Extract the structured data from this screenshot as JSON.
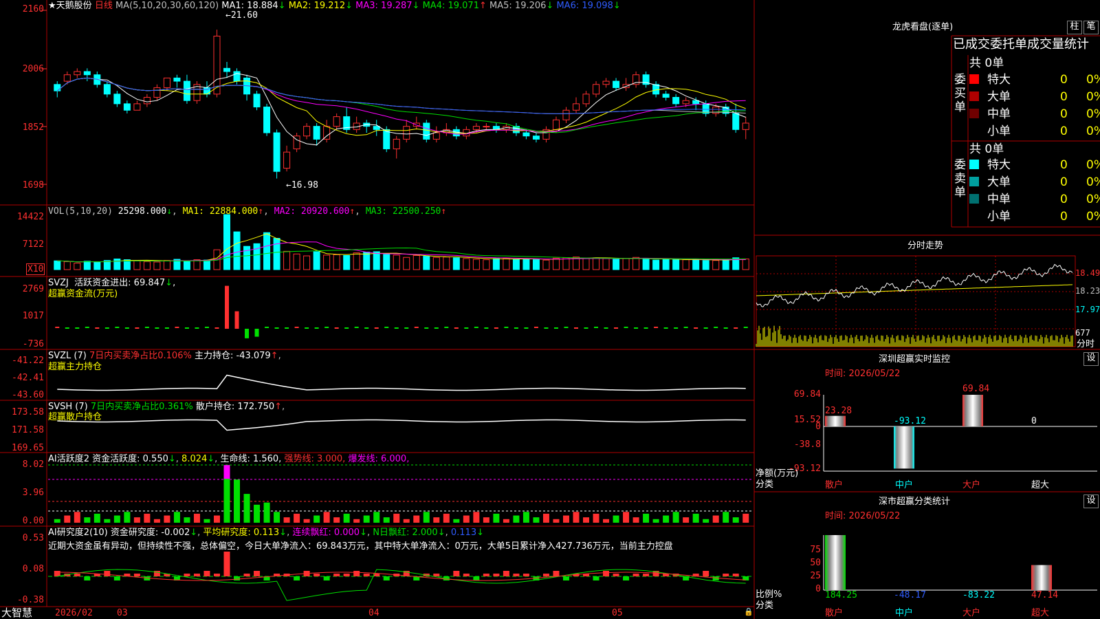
{
  "stock": {
    "name": "天鹅股份",
    "star": "★",
    "period": "日线"
  },
  "main": {
    "params": "MA(5,10,20,30,60,120)",
    "y_ticks": [
      "2160",
      "2006",
      "1852",
      "1698"
    ],
    "ma": [
      {
        "label": "MA1: 18.884",
        "arrow": "↓",
        "color": "#ffffff"
      },
      {
        "label": "MA2: 19.212",
        "arrow": "↓",
        "color": "#ffff00"
      },
      {
        "label": "MA3: 19.287",
        "arrow": "↓",
        "color": "#ff00ff"
      },
      {
        "label": "MA4: 19.071",
        "arrow": "↑",
        "color": "#00e000"
      },
      {
        "label": "MA5: 19.206",
        "arrow": "↓",
        "color": "#c0c0c0"
      },
      {
        "label": "MA6: 19.098",
        "arrow": "↓",
        "color": "#2f5cff"
      }
    ],
    "high_label": "21.60",
    "low_label": "16.98"
  },
  "vol": {
    "params": "VOL(5,10,20)",
    "value": "25298.000",
    "ma1": "MA1: 22884.000",
    "ma2": "MA2: 20920.600",
    "ma3": "MA3: 22500.250",
    "y_ticks": [
      "14422",
      "7122"
    ],
    "unit": "X10"
  },
  "svzj": {
    "label": "SVZJ",
    "desc": "活跃资金进出: 69.847",
    "title": "超赢资金流(万元)",
    "y_ticks": [
      "2769",
      "1017",
      "-736"
    ]
  },
  "svzl": {
    "label": "SVZL (7)",
    "ratio": "7日内买卖净占比0.106%",
    "hold": "主力持仓: -43.079",
    "title": "超赢主力持仓",
    "y_ticks": [
      "-41.22",
      "-42.41",
      "-43.60"
    ]
  },
  "svsh": {
    "label": "SVSH (7)",
    "ratio": "7日内买卖净占比0.361%",
    "hold": "散户持仓: 172.750",
    "title": "超赢散户持仓",
    "y_ticks": [
      "173.58",
      "171.58",
      "169.65"
    ]
  },
  "ai_active": {
    "label": "AI活跃度2",
    "active": "资金活跃度: 0.550",
    "v2": "8.024",
    "life": "生命线: 1.560,",
    "strong": "强势线: 3.000,",
    "burst": "爆发线: 6.000,",
    "y_ticks": [
      "8.02",
      "3.96",
      "0.00"
    ]
  },
  "ai_research": {
    "label": "AI研究度2(10)",
    "research": "资金研究度: -0.002",
    "avg": "平均研究度: 0.113",
    "lianxu": "连续飘红: 0.000",
    "nri": "N日飘红: 2.000",
    "last": "0.113",
    "y_ticks": [
      "0.53",
      "0.08",
      "-0.38"
    ],
    "comment": "近期大资金虽有异动，但持续性不强，总体偏空，今日大单净流入：69.843万元，其中特大单净流入：0万元，大单5日累计净入427.736万元，当前主力控盘"
  },
  "footer": {
    "brand": "大智慧",
    "dates": [
      "2026/02",
      "03",
      "04",
      "05"
    ]
  },
  "right": {
    "lhb": {
      "title": "龙虎看盘(逐单)",
      "btn_zhu": "柱",
      "btn_bi": "笔"
    },
    "tabs": [
      "已成交",
      "委托单",
      "成交量",
      "统计"
    ],
    "buy": {
      "side": "委买单",
      "total": "共 0单",
      "rows": [
        {
          "label": "特大",
          "val": "0",
          "pct": "0%",
          "color": "#ff0000"
        },
        {
          "label": "大单",
          "val": "0",
          "pct": "0%",
          "color": "#b00000"
        },
        {
          "label": "中单",
          "val": "0",
          "pct": "0%",
          "color": "#700000"
        },
        {
          "label": "小单",
          "val": "0",
          "pct": "0%",
          "color": ""
        }
      ]
    },
    "sell": {
      "side": "委卖单",
      "total": "共 0单",
      "rows": [
        {
          "label": "特大",
          "val": "0",
          "pct": "0%",
          "color": "#00ffff"
        },
        {
          "label": "大单",
          "val": "0",
          "pct": "0%",
          "color": "#00a0a0"
        },
        {
          "label": "中单",
          "val": "0",
          "pct": "0%",
          "color": "#007070"
        },
        {
          "label": "小单",
          "val": "0",
          "pct": "0%",
          "color": ""
        }
      ]
    },
    "intraday": {
      "title": "分时走势",
      "y_ticks": [
        "18.49",
        "18.23",
        "17.97"
      ],
      "vol_label": "677",
      "footer": "分时"
    },
    "sz_monitor": {
      "title": "深圳超赢实时监控",
      "btn": "设",
      "time": "时间: 2026/05/22",
      "y_ticks": [
        "69.84",
        "15.52",
        "0",
        "-38.8",
        "-93.12"
      ],
      "ylabel": "净额(万元)",
      "xlabel": "分类",
      "categories": [
        "散户",
        "中户",
        "大户",
        "超大"
      ],
      "values": [
        "23.28",
        "-93.12",
        "69.84",
        "0"
      ]
    },
    "sz_class": {
      "title": "深市超赢分类统计",
      "btn": "设",
      "time": "时间: 2026/05/22",
      "y_ticks": [
        "75",
        "50",
        "25",
        "0"
      ],
      "ylabel": "比例%",
      "xlabel": "分类",
      "categories": [
        "散户",
        "中户",
        "大户",
        "超大"
      ],
      "values": [
        "184.25",
        "-48.17",
        "-83.22",
        "47.14"
      ]
    }
  },
  "chart_data": [
    {
      "type": "candlestick",
      "title": "天鹅股份 日线",
      "ylim": [
        16.98,
        21.6
      ],
      "candles": [
        [
          19.9,
          19.7,
          20.0,
          19.5
        ],
        [
          20.0,
          20.2,
          20.3,
          19.9
        ],
        [
          20.2,
          20.3,
          20.4,
          20.1
        ],
        [
          20.3,
          20.2,
          20.4,
          20.0
        ],
        [
          20.2,
          19.9,
          20.3,
          19.8
        ],
        [
          19.9,
          19.6,
          20.0,
          19.5
        ],
        [
          19.6,
          19.3,
          19.7,
          19.2
        ],
        [
          19.3,
          19.1,
          19.4,
          19.0
        ],
        [
          19.1,
          19.3,
          19.4,
          19.1
        ],
        [
          19.3,
          19.5,
          19.6,
          19.2
        ],
        [
          19.5,
          19.8,
          19.9,
          19.4
        ],
        [
          19.8,
          20.1,
          20.1,
          19.7
        ],
        [
          20.1,
          20.0,
          20.2,
          19.8
        ],
        [
          20.0,
          19.4,
          20.2,
          19.3
        ],
        [
          19.4,
          19.9,
          20.0,
          19.3
        ],
        [
          19.8,
          19.6,
          20.0,
          19.5
        ],
        [
          19.6,
          21.4,
          21.6,
          19.5
        ],
        [
          20.4,
          20.3,
          20.6,
          20.1
        ],
        [
          20.3,
          20.0,
          20.4,
          19.9
        ],
        [
          20.1,
          19.6,
          20.2,
          19.4
        ],
        [
          19.6,
          19.2,
          19.7,
          19.1
        ],
        [
          19.2,
          18.4,
          19.3,
          18.3
        ],
        [
          18.4,
          17.2,
          18.5,
          16.98
        ],
        [
          17.3,
          17.8,
          18.0,
          17.2
        ],
        [
          17.9,
          18.3,
          18.4,
          17.8
        ],
        [
          18.3,
          18.6,
          18.7,
          18.2
        ],
        [
          18.6,
          18.2,
          18.7,
          18.0
        ],
        [
          18.2,
          18.6,
          18.8,
          18.1
        ],
        [
          18.6,
          18.9,
          19.0,
          18.5
        ],
        [
          18.9,
          18.5,
          19.2,
          18.4
        ],
        [
          18.5,
          18.7,
          18.9,
          18.4
        ],
        [
          18.7,
          18.6,
          18.8,
          18.4
        ],
        [
          18.6,
          18.5,
          18.8,
          18.3
        ],
        [
          18.5,
          17.9,
          18.6,
          17.8
        ],
        [
          17.9,
          18.2,
          18.3,
          17.6
        ],
        [
          18.2,
          18.6,
          18.8,
          18.1
        ],
        [
          18.6,
          18.7,
          18.9,
          18.5
        ],
        [
          18.7,
          18.2,
          18.8,
          18.1
        ],
        [
          18.2,
          18.4,
          18.6,
          18.1
        ],
        [
          18.4,
          18.5,
          18.7,
          18.3
        ],
        [
          18.5,
          18.3,
          18.6,
          18.2
        ],
        [
          18.3,
          18.5,
          18.6,
          18.2
        ],
        [
          18.5,
          18.6,
          18.7,
          18.4
        ],
        [
          18.6,
          18.6,
          18.7,
          18.5
        ],
        [
          18.6,
          18.5,
          18.7,
          18.4
        ],
        [
          18.5,
          18.6,
          18.7,
          18.4
        ],
        [
          18.6,
          18.4,
          18.7,
          18.3
        ],
        [
          18.4,
          18.3,
          18.5,
          18.2
        ],
        [
          18.3,
          18.2,
          18.4,
          18.1
        ],
        [
          18.2,
          18.5,
          18.6,
          18.1
        ],
        [
          18.5,
          18.8,
          18.9,
          18.4
        ],
        [
          18.8,
          19.1,
          19.2,
          18.7
        ],
        [
          19.1,
          19.3,
          19.5,
          19.0
        ],
        [
          19.3,
          19.6,
          19.7,
          19.2
        ],
        [
          19.6,
          19.9,
          20.0,
          19.5
        ],
        [
          19.9,
          20.0,
          20.1,
          19.8
        ],
        [
          20.0,
          19.8,
          20.1,
          19.7
        ],
        [
          19.8,
          19.9,
          20.1,
          19.7
        ],
        [
          19.9,
          20.2,
          20.3,
          19.8
        ],
        [
          20.2,
          19.9,
          20.3,
          19.8
        ],
        [
          19.9,
          19.6,
          20.0,
          19.5
        ],
        [
          19.6,
          19.5,
          19.7,
          19.4
        ],
        [
          19.5,
          19.3,
          19.6,
          19.2
        ],
        [
          19.3,
          19.4,
          19.5,
          19.2
        ],
        [
          19.4,
          19.3,
          19.5,
          19.1
        ],
        [
          19.3,
          19.0,
          19.4,
          18.9
        ],
        [
          19.0,
          19.2,
          19.3,
          18.9
        ],
        [
          19.2,
          19.0,
          19.3,
          18.9
        ],
        [
          19.0,
          18.5,
          19.3,
          18.4
        ],
        [
          18.5,
          18.7,
          18.9,
          18.2
        ]
      ]
    },
    {
      "type": "bar",
      "title": "VOL(5,10,20)",
      "ylim": [
        0,
        14422
      ],
      "values": [
        2300,
        2100,
        1700,
        2200,
        2000,
        2400,
        2800,
        2600,
        2400,
        2100,
        2000,
        2400,
        2700,
        2100,
        2600,
        2500,
        5200,
        14422,
        9900,
        6100,
        6800,
        9700,
        8200,
        4800,
        4100,
        3600,
        4700,
        3800,
        3900,
        3700,
        4400,
        4600,
        4700,
        4000,
        3800,
        3200,
        3700,
        3500,
        3200,
        3300,
        3100,
        2900,
        2700,
        2600,
        2900,
        3000,
        2700,
        2800,
        2600,
        2500,
        3000,
        3100,
        3300,
        3000,
        3100,
        2900,
        2700,
        2900,
        3200,
        2700,
        2500,
        2700,
        2600,
        2600,
        2700,
        2400,
        2400,
        2500,
        3100,
        2800
      ]
    },
    {
      "type": "bar",
      "title": "超赢资金流(万元)",
      "ylim": [
        -736,
        2769
      ],
      "values": [
        0,
        0,
        0,
        0,
        0,
        0,
        0,
        0,
        0,
        0,
        0,
        0,
        0,
        0,
        0,
        0,
        0,
        2700,
        1100,
        -600,
        -500,
        0,
        0,
        0,
        0,
        0,
        0,
        0,
        0,
        0,
        0,
        0,
        0,
        0,
        0,
        0,
        0,
        0,
        0,
        0,
        0,
        0,
        0,
        0,
        0,
        0,
        0,
        0,
        0,
        0,
        0,
        0,
        0,
        0,
        0,
        0,
        0,
        0,
        0,
        0,
        0,
        0,
        0,
        0,
        0,
        0,
        0,
        0,
        0,
        0
      ]
    },
    {
      "type": "bar",
      "title": "深圳超赢实时监控",
      "categories": [
        "散户",
        "中户",
        "大户",
        "超大"
      ],
      "values": [
        23.28,
        -93.12,
        69.84,
        0
      ],
      "ylim": [
        -93.12,
        69.84
      ],
      "ylabel": "净额(万元)",
      "xlabel": "分类"
    },
    {
      "type": "bar",
      "title": "深市超赢分类统计",
      "categories": [
        "散户",
        "中户",
        "大户",
        "超大"
      ],
      "values": [
        184.25,
        -48.17,
        -83.22,
        47.14
      ],
      "ylim": [
        0,
        75
      ],
      "ylabel": "比例%",
      "xlabel": "分类"
    }
  ]
}
